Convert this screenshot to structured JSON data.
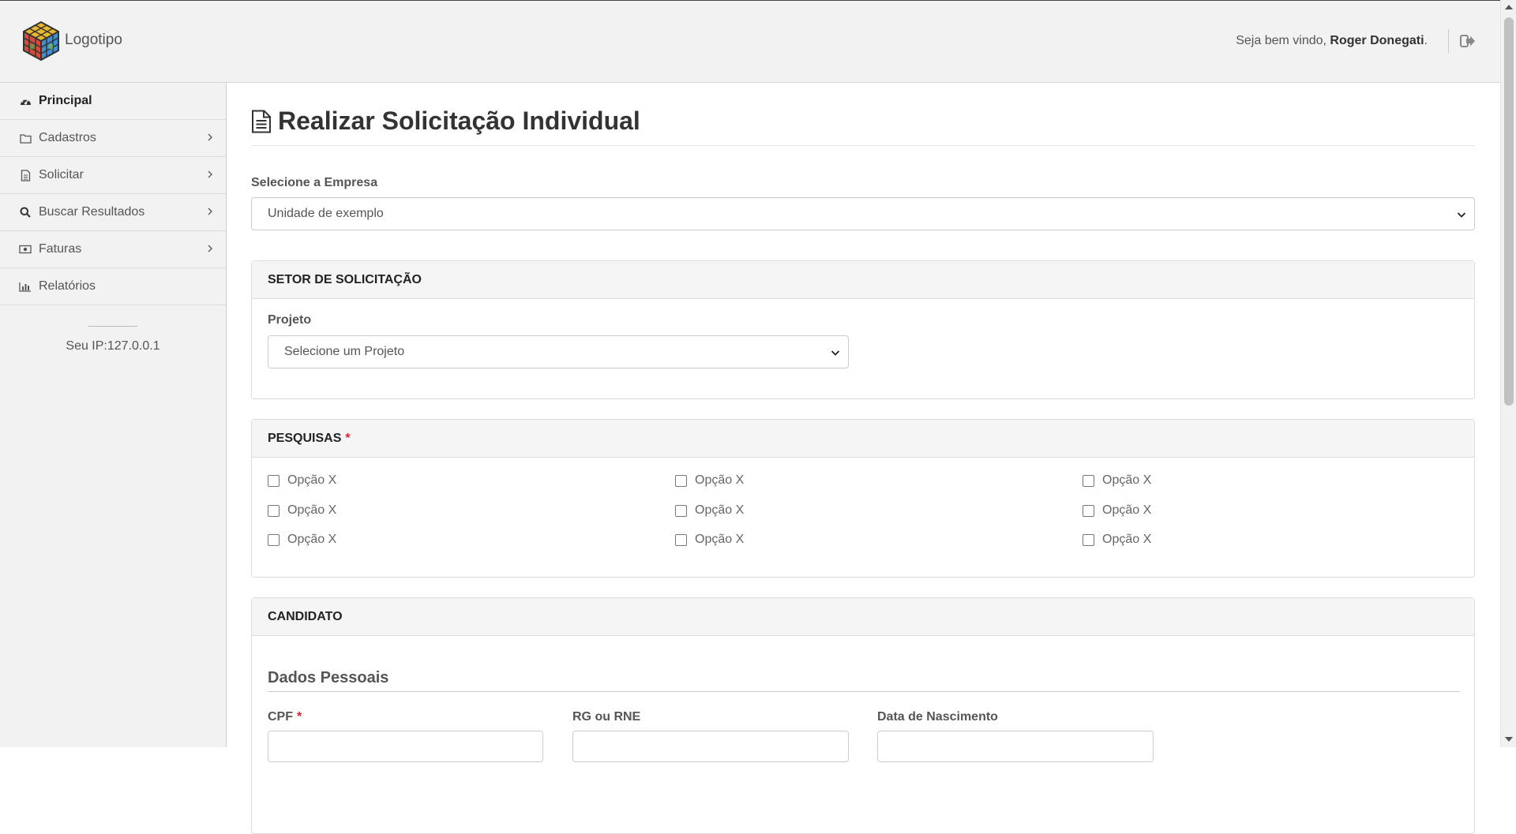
{
  "header": {
    "logo_text": "Logotipo",
    "welcome_prefix": "Seja bem vindo, ",
    "user_name": "Roger Donegati",
    "welcome_suffix": "."
  },
  "sidebar": {
    "items": [
      {
        "label": "Principal",
        "icon": "dashboard-icon",
        "active": true
      },
      {
        "label": "Cadastros",
        "icon": "folder-icon",
        "has_submenu": true
      },
      {
        "label": "Solicitar",
        "icon": "file-icon",
        "has_submenu": true
      },
      {
        "label": "Buscar Resultados",
        "icon": "search-icon",
        "has_submenu": true
      },
      {
        "label": "Faturas",
        "icon": "money-icon",
        "has_submenu": true
      },
      {
        "label": "Relatórios",
        "icon": "bar-chart-icon"
      }
    ],
    "ip_text": "Seu IP:127.0.0.1"
  },
  "main": {
    "title": "Realizar Solicitação Individual",
    "empresa_label": "Selecione a Empresa",
    "empresa_value": "Unidade de exemplo",
    "setor": {
      "heading": "SETOR DE SOLICITAÇÃO",
      "projeto_label": "Projeto",
      "projeto_value": "Selecione um Projeto"
    },
    "pesquisas": {
      "heading": "PESQUISAS",
      "required_mark": "*",
      "options": [
        "Opção X",
        "Opção X",
        "Opção X",
        "Opção X",
        "Opção X",
        "Opção X",
        "Opção X",
        "Opção X",
        "Opção X"
      ]
    },
    "candidato": {
      "heading": "CANDIDATO",
      "subheading": "Dados Pessoais",
      "cpf_label": "CPF",
      "cpf_required": "*",
      "rg_label": "RG ou RNE",
      "nascimento_label": "Data de Nascimento"
    }
  }
}
